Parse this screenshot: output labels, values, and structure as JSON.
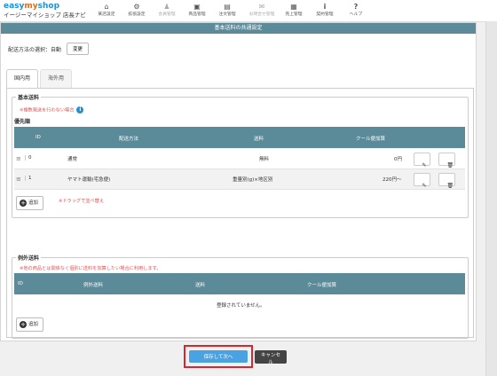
{
  "header": {
    "brand_part1": "easy",
    "brand_part2": "my",
    "brand_part3": "shop",
    "shop_name": "イージーマイショップ 店長ナビ",
    "nav": [
      {
        "label": "某店設定",
        "icon": "home-icon"
      },
      {
        "label": "拡張設定",
        "icon": "gear-icon"
      },
      {
        "label": "会員管理",
        "icon": "user-icon"
      },
      {
        "label": "商品管理",
        "icon": "gift-icon"
      },
      {
        "label": "注文管理",
        "icon": "document-icon"
      },
      {
        "label": "お問合せ管理",
        "icon": "mail-icon"
      },
      {
        "label": "売上管理",
        "icon": "calculator-icon"
      },
      {
        "label": "契約管理",
        "icon": "info-icon"
      },
      {
        "label": "ヘルプ",
        "icon": "question-icon"
      }
    ]
  },
  "panel": {
    "title": "基本送料の共通設定",
    "method_label": "配送方法の選択：",
    "method_value": "自動",
    "change_button": "変更"
  },
  "tabs": [
    {
      "label": "国内用",
      "active": true
    },
    {
      "label": "海外用",
      "active": false
    }
  ],
  "basic": {
    "legend": "基本送料",
    "note": "※複数発送を行わない場合",
    "priority_label": "優先順",
    "columns": [
      "ID",
      "配送方法",
      "送料",
      "クール便加算"
    ],
    "rows": [
      {
        "id": "0",
        "method": "通常",
        "fee": "無料",
        "cool": "0円"
      },
      {
        "id": "1",
        "method": "ヤマト運輸(宅急便)",
        "fee": "重量別(g)×地区別",
        "cool": "220円～"
      }
    ],
    "add_button": "追加",
    "drag_note": "※ドラッグで並べ替え"
  },
  "exception": {
    "legend": "例外送料",
    "note": "※他の商品とは関係なく個別に送料を加算したい場合に利用します。",
    "columns": [
      "ID",
      "例外送料",
      "送料",
      "クール便加算"
    ],
    "empty_text": "登録されていません。",
    "add_button": "追加"
  },
  "footer": {
    "save_button": "保存して次へ",
    "cancel_button": "キャンセル"
  },
  "colors": {
    "header_bar": "#5b8a99",
    "save_blue": "#4aa3e0",
    "highlight_red": "#d6262f",
    "note_red": "#e05353",
    "brand_blue": "#1e90d6",
    "brand_orange": "#e06a1b"
  }
}
